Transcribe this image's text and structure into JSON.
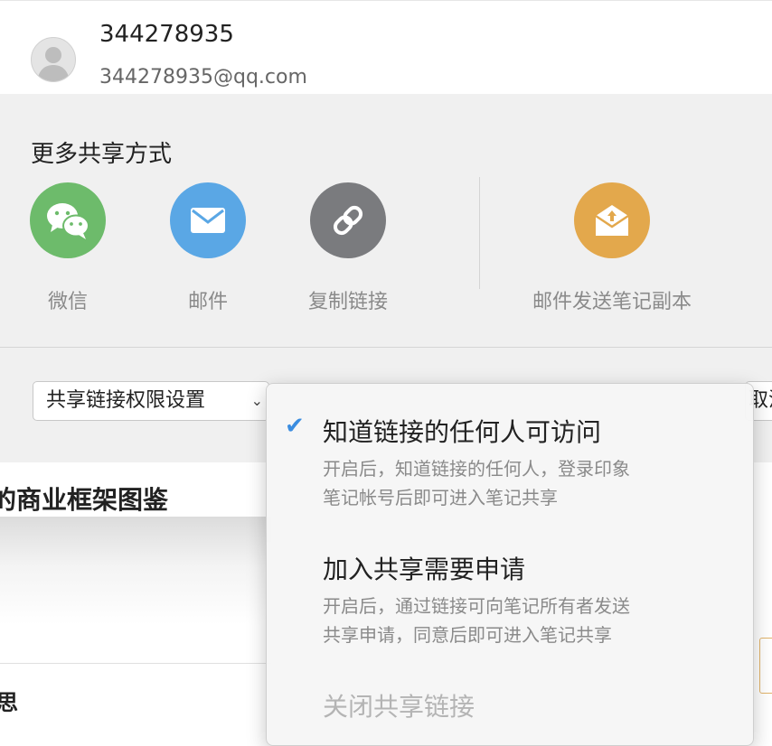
{
  "user": {
    "name": "344278935",
    "email": "344278935@qq.com"
  },
  "share": {
    "title": "更多共享方式",
    "options": [
      {
        "label": "微信",
        "icon": "wechat-icon",
        "color": "#6dbb6b"
      },
      {
        "label": "邮件",
        "icon": "mail-icon",
        "color": "#5aa7e5"
      },
      {
        "label": "复制链接",
        "icon": "link-icon",
        "color": "#7a7b7e"
      },
      {
        "label": "邮件发送笔记副本",
        "icon": "mail-copy-icon",
        "color": "#e3a84c"
      }
    ],
    "permission_label": "共享链接权限设置",
    "cancel_partial": "取消"
  },
  "document": {
    "title": "的商业框架图鉴",
    "bottom_text": "思"
  },
  "dropdown": {
    "accent": "#3b8de0",
    "items": [
      {
        "title": "知道链接的任何人可访问",
        "desc_line1": "开启后，知道链接的任何人，登录印象",
        "desc_line2": "笔记帐号后即可进入笔记共享",
        "checked": true
      },
      {
        "title": "加入共享需要申请",
        "desc_line1": "开启后，通过链接可向笔记所有者发送",
        "desc_line2": "共享申请，同意后即可进入笔记共享",
        "checked": false
      },
      {
        "title": "关闭共享链接",
        "checked": false
      }
    ]
  }
}
